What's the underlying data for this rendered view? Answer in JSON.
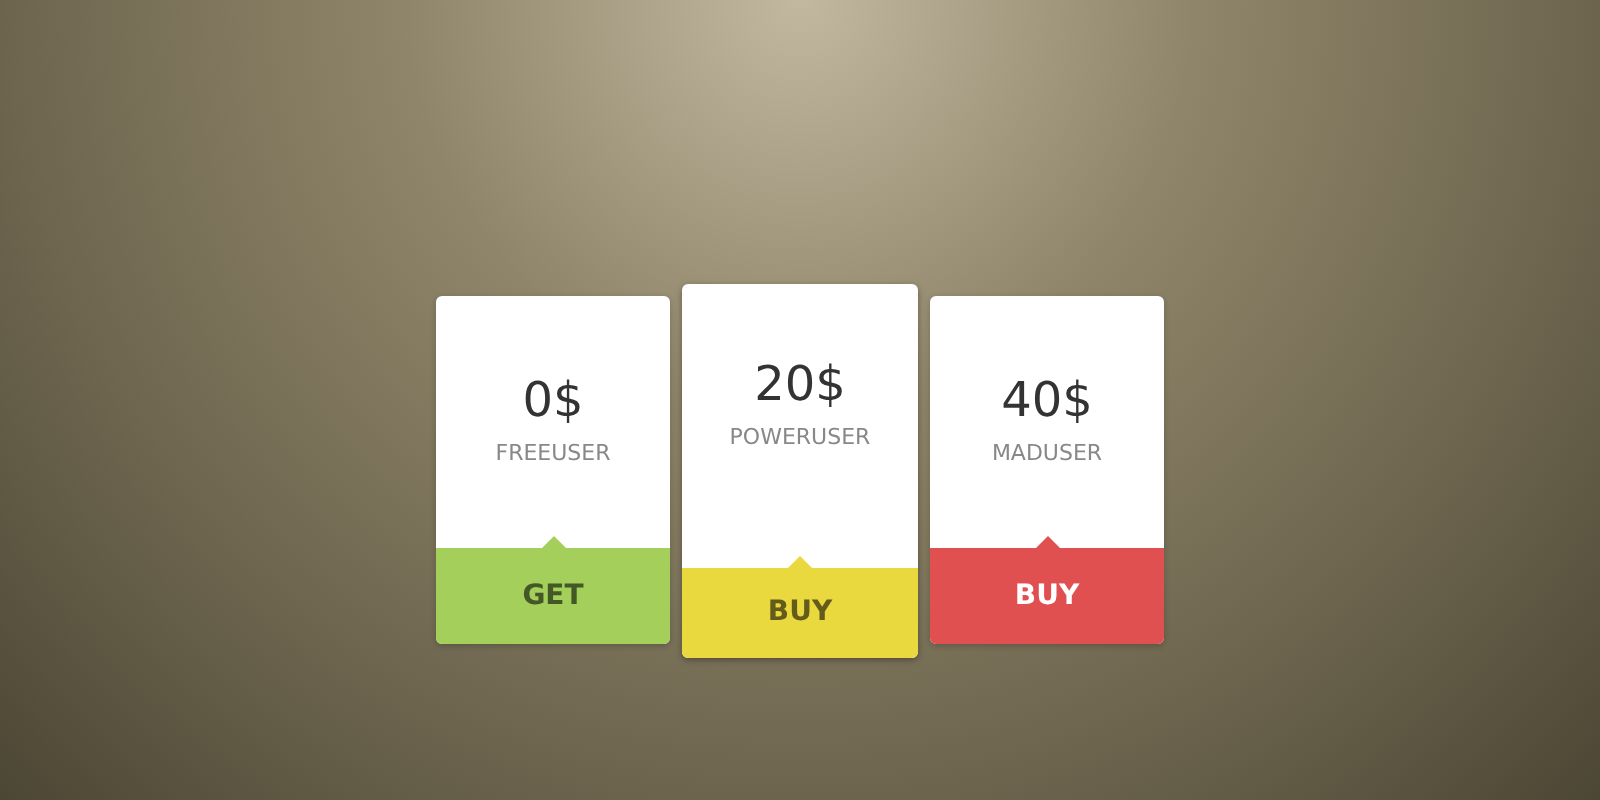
{
  "plans": [
    {
      "price": "0$",
      "name": "FREEUSER",
      "action": "GET",
      "color": "#a3cf5a",
      "featured": false
    },
    {
      "price": "20$",
      "name": "POWERUSER",
      "action": "BUY",
      "color": "#e9d83e",
      "featured": true
    },
    {
      "price": "40$",
      "name": "MADUSER",
      "action": "BUY",
      "color": "#e05050",
      "featured": false
    }
  ]
}
